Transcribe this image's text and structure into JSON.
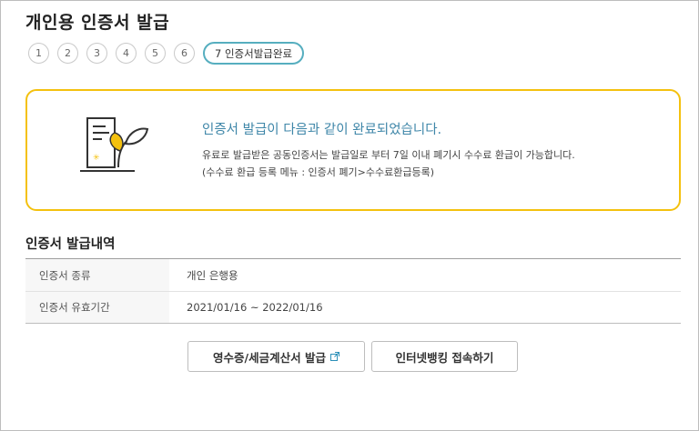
{
  "page": {
    "title": "개인용 인증서 발급"
  },
  "steps": [
    "1",
    "2",
    "3",
    "4",
    "5",
    "6"
  ],
  "active_step": "7 인증서발급완료",
  "result": {
    "title": "인증서 발급이 다음과 같이 완료되었습니다.",
    "desc_line1": "유료로 발급받은 공동인증서는 발급일로 부터 7일 이내 폐기시 수수료 환급이 가능합니다.",
    "desc_line2": "(수수료 환급 등록 메뉴 : 인증서 폐기>수수료환급등록)"
  },
  "history": {
    "title": "인증서 발급내역",
    "rows": [
      {
        "label": "인증서 종류",
        "value": "개인 은행용"
      },
      {
        "label": "인증서 유효기간",
        "value": "2021/01/16 ~ 2022/01/16"
      }
    ]
  },
  "buttons": {
    "receipt": "영수증/세금계산서 발급",
    "banking": "인터넷뱅킹 접속하기"
  },
  "colors": {
    "accent_yellow": "#f4c10e",
    "accent_blue": "#3e86a8",
    "step_active_border": "#56aebf"
  }
}
